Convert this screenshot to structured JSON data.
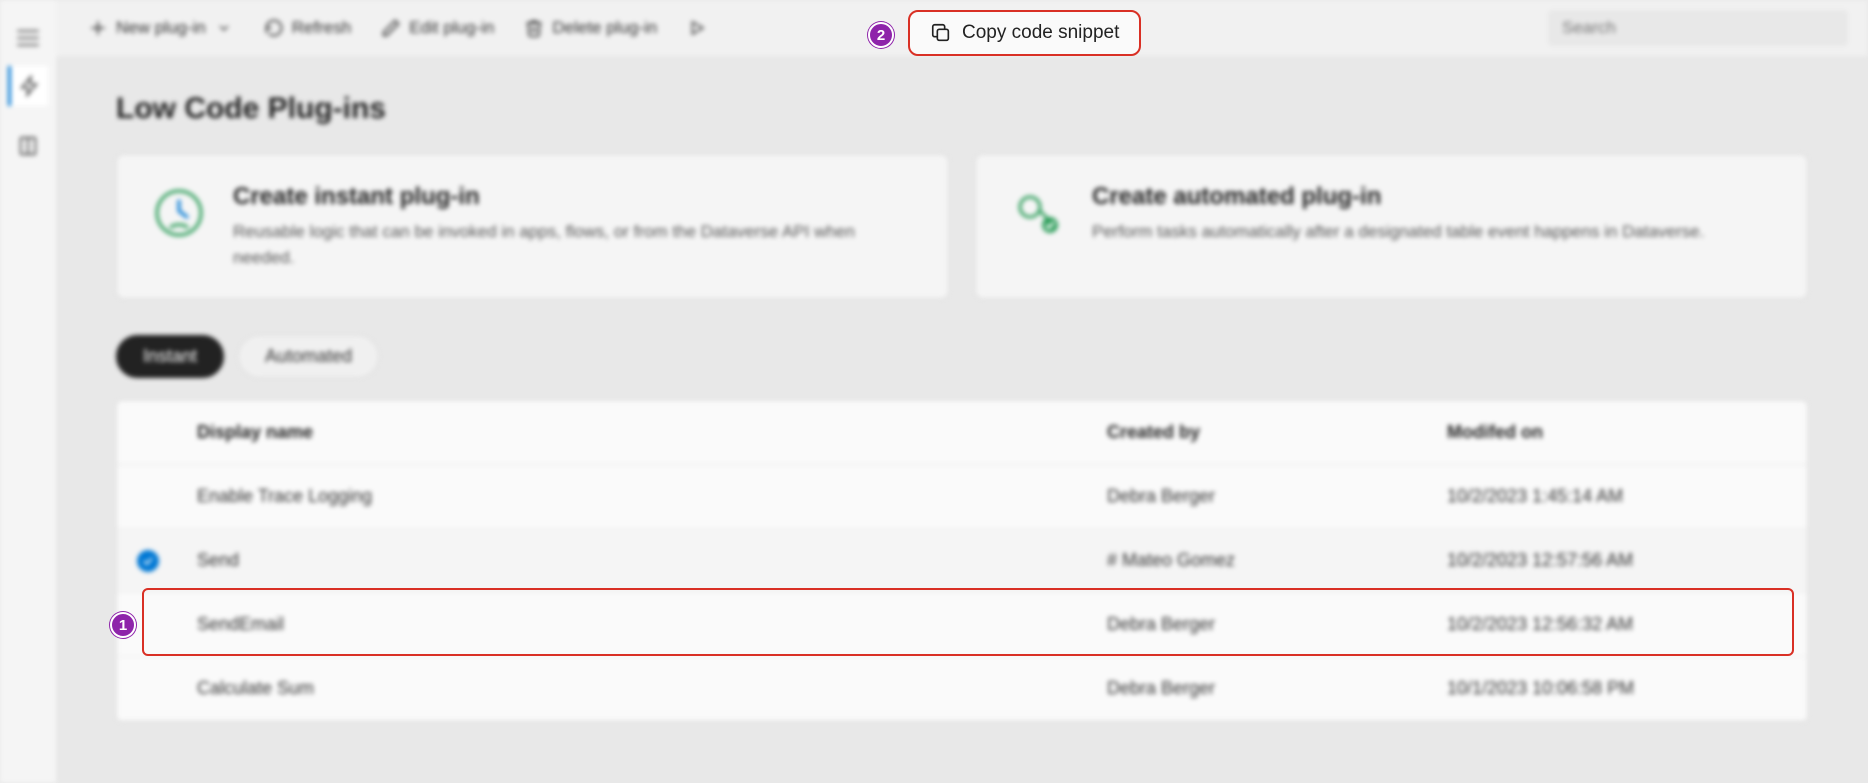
{
  "toolbar": {
    "new_plugin": "New plug-in",
    "refresh": "Refresh",
    "edit": "Edit plug-in",
    "delete": "Delete plug-in",
    "copy_snippet": "Copy code snippet",
    "search_placeholder": "Search"
  },
  "page": {
    "title": "Low Code Plug-ins"
  },
  "cards": {
    "instant": {
      "title": "Create instant plug-in",
      "desc": "Reusable logic that can be invoked in apps, flows, or from the Dataverse API when needed."
    },
    "automated": {
      "title": "Create automated plug-in",
      "desc": "Perform tasks automatically after a designated table event happens in Dataverse."
    }
  },
  "tabs": {
    "instant": "Instant",
    "automated": "Automated"
  },
  "table": {
    "headers": {
      "display_name": "Display name",
      "created_by": "Created by",
      "modified_on": "Modifed on"
    },
    "rows": [
      {
        "name": "Enable Trace Logging",
        "by": "Debra Berger",
        "on": "10/2/2023 1:45:14 AM",
        "selected": false
      },
      {
        "name": "Send",
        "by": "# Mateo Gomez",
        "on": "10/2/2023 12:57:56 AM",
        "selected": true
      },
      {
        "name": "SendEmail",
        "by": "Debra Berger",
        "on": "10/2/2023 12:56:32 AM",
        "selected": false
      },
      {
        "name": "Calculate Sum",
        "by": "Debra Berger",
        "on": "10/1/2023 10:06:58 PM",
        "selected": false
      }
    ]
  },
  "annotations": {
    "badge1": "1",
    "badge2": "2"
  }
}
